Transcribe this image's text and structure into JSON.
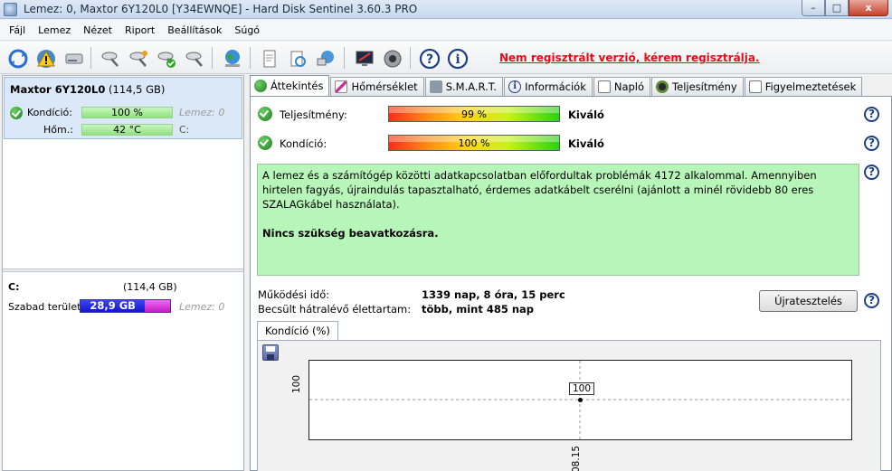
{
  "window": {
    "title": "Lemez: 0, Maxtor 6Y120L0 [Y34EWNQE]  -  Hard Disk Sentinel 3.60.3 PRO",
    "minimize": "–",
    "maximize": "□",
    "close": "x"
  },
  "menu": [
    "Fájl",
    "Lemez",
    "Nézet",
    "Riport",
    "Beállítások",
    "Súgó"
  ],
  "toolbar": {
    "register_link": "Nem regisztrált verzió, kérem regisztrálja."
  },
  "disk": {
    "model": "Maxtor 6Y120L0",
    "size": "(114,5 GB)",
    "condition_label": "Kondíció:",
    "condition_value": "100 %",
    "condition_disk": "Lemez: 0",
    "temp_label": "Hőm.:",
    "temp_value": "42 °C",
    "temp_drive": "C:"
  },
  "volume": {
    "letter": "C:",
    "size": "(114,4 GB)",
    "free_label": "Szabad terület",
    "free_value": "28,9 GB",
    "free_fraction": 0.72,
    "disk": "Lemez: 0"
  },
  "tabs": [
    "Áttekintés",
    "Hőmérséklet",
    "S.M.A.R.T.",
    "Információk",
    "Napló",
    "Teljesítmény",
    "Figyelmeztetések"
  ],
  "overview": {
    "performance_label": "Teljesítmény:",
    "performance_value": "99 %",
    "performance_rating": "Kiváló",
    "condition_label": "Kondíció:",
    "condition_value": "100 %",
    "condition_rating": "Kiváló",
    "report_text": "A lemez és a számítógép közötti adatkapcsolatban előfordultak problémák 4172 alkalommal. Amennyiben hirtelen fagyás, újraindulás tapasztalható, érdemes adatkábelt cserélni (ajánlott a minél rövidebb 80 eres SZALAGkábel használata).",
    "report_action": "Nincs szükség beavatkozásra.",
    "uptime_label": "Működési idő:",
    "uptime_value": "1339 nap, 8 óra, 15 perc",
    "remaining_label": "Becsült hátralévő élettartam:",
    "remaining_value": "több, mint 485 nap",
    "retest_button": "Újratesztelés",
    "help": "?"
  },
  "chart_tab_label": "Kondíció  (%)",
  "chart_data": {
    "type": "line",
    "x": [
      "08.15"
    ],
    "series": [
      {
        "values": [
          100
        ]
      }
    ],
    "data_labels": [
      "100"
    ],
    "y_tick_labels": [
      "100"
    ],
    "x_tick_labels": [
      "08.15"
    ],
    "grid": true
  }
}
